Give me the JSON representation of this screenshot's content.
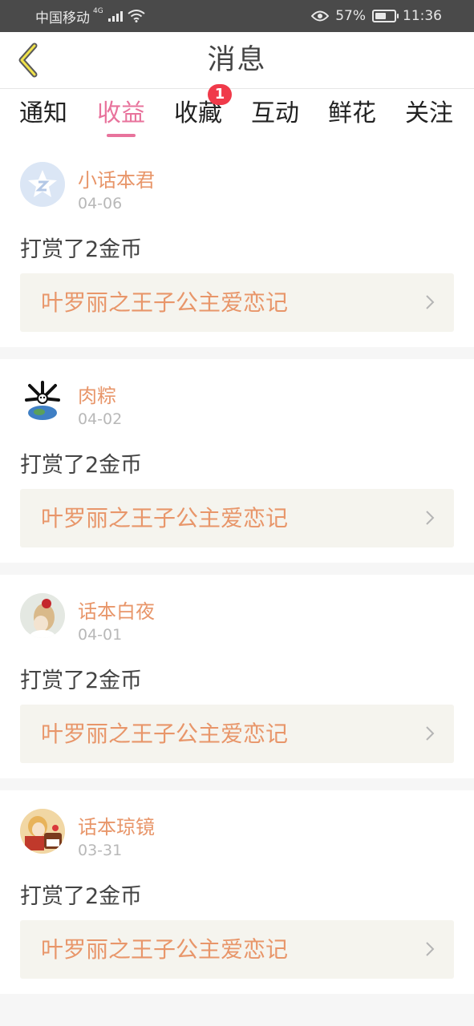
{
  "status_bar": {
    "carrier": "中国移动",
    "network": "4G",
    "battery": "57%",
    "battery_level": 0.57,
    "time": "11:36"
  },
  "nav": {
    "title": "消息"
  },
  "tabs": [
    {
      "label": "通知",
      "active": false
    },
    {
      "label": "收益",
      "active": true
    },
    {
      "label": "收藏",
      "active": false,
      "badge": "1"
    },
    {
      "label": "互动",
      "active": false
    },
    {
      "label": "鲜花",
      "active": false
    },
    {
      "label": "关注",
      "active": false
    }
  ],
  "colors": {
    "accent": "#e8739c",
    "name": "#e8966a",
    "badge": "#f03a4a",
    "book_bg": "#f5f4ee"
  },
  "messages": [
    {
      "user": "小话本君",
      "date": "04-06",
      "text": "打赏了2金币",
      "book": "叶罗丽之王子公主爱恋记",
      "avatar_icon": "star-logo-icon"
    },
    {
      "user": "肉粽",
      "date": "04-02",
      "text": "打赏了2金币",
      "book": "叶罗丽之王子公主爱恋记",
      "avatar_icon": "globe-bones-icon"
    },
    {
      "user": "话本白夜",
      "date": "04-01",
      "text": "打赏了2金币",
      "book": "叶罗丽之王子公主爱恋记",
      "avatar_icon": "girl-portrait-icon"
    },
    {
      "user": "话本琼镜",
      "date": "03-31",
      "text": "打赏了2金币",
      "book": "叶罗丽之王子公主爱恋记",
      "avatar_icon": "anime-portrait-icon"
    }
  ]
}
